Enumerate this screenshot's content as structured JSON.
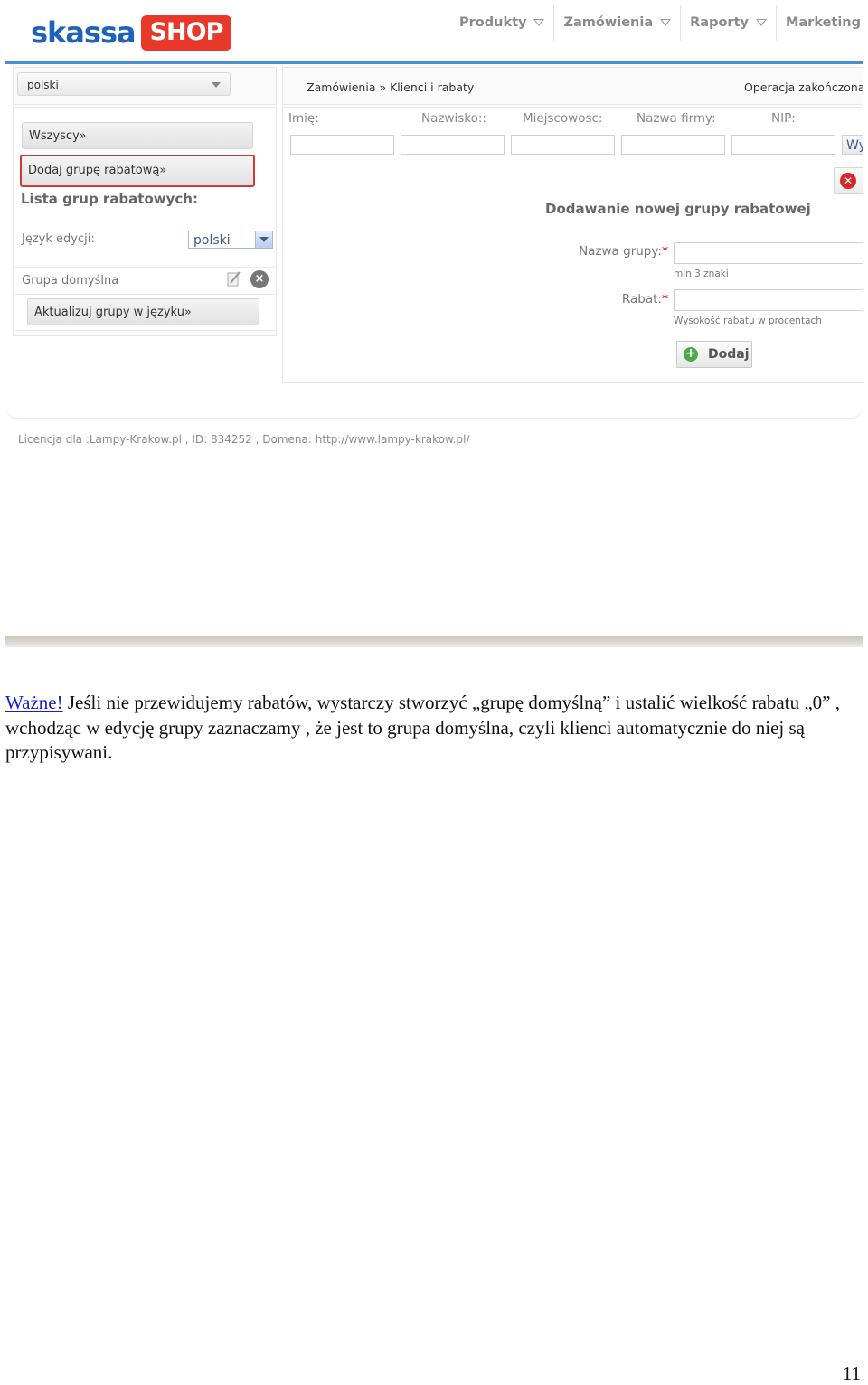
{
  "header": {
    "logo_part1": "skassa",
    "logo_part2": "SHOP",
    "nav": [
      "Produkty",
      "Zamówienia",
      "Raporty",
      "Marketing"
    ]
  },
  "sidebar": {
    "language_select": "polski",
    "all_button": "Wszyscy»",
    "add_group_button": "Dodaj grupę rabatową»",
    "list_heading": "Lista grup rabatowych:",
    "edit_language_label": "Język edycji:",
    "edit_language_value": "polski",
    "default_group_label": "Grupa domyślna",
    "update_button": "Aktualizuj grupy w języku»"
  },
  "main": {
    "breadcrumb": "Zamówienia » Klienci i rabaty",
    "status": "Operacja zakończona s",
    "filters": {
      "labels": [
        "Imię:",
        "Nazwisko::",
        "Miejscowosc:",
        "Nazwa firmy:",
        "NIP:"
      ],
      "search_button": "Wy"
    },
    "form": {
      "title": "Dodawanie nowej grupy rabatowej",
      "name_label": "Nazwa grupy:",
      "name_hint": "min 3 znaki",
      "discount_label": "Rabat:",
      "discount_hint": "Wysokość rabatu w procentach",
      "required_mark": "*",
      "submit": "Dodaj"
    }
  },
  "footer": {
    "license": "Licencja dla :Lampy-Krakow.pl , ID: 834252 , Domena: http://www.lampy-krakow.pl/"
  },
  "document": {
    "link": "Ważne!",
    "text": " Jeśli nie przewidujemy rabatów, wystarczy stworzyć „grupę domyślną” i ustalić wielkość rabatu „0” , wchodząc w edycję grupy zaznaczamy , że jest to grupa domyślna, czyli klienci automatycznie do niej są przypisywani.",
    "page_number": "11"
  },
  "colors": {
    "accent_blue": "#4a8fd8",
    "logo_blue": "#1f63b8",
    "logo_red": "#e8382a",
    "highlight_red": "#cc3a3a",
    "link": "#1a1ad6"
  }
}
